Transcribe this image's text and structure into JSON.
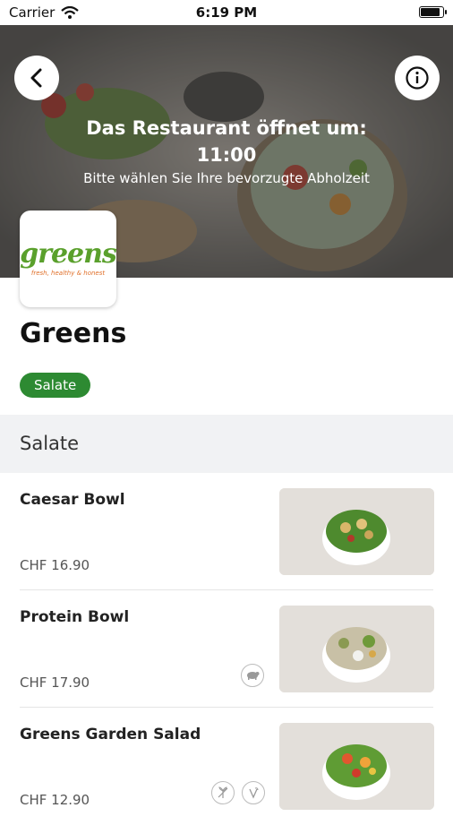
{
  "status_bar": {
    "carrier": "Carrier",
    "time": "6:19 PM",
    "battery_level": 0.9
  },
  "header": {
    "title": "Das Restaurant öffnet um:",
    "opening_time": "11:00",
    "subtitle": "Bitte wählen Sie Ihre bevorzugte Abholzeit",
    "back_icon": "chevron-left-icon",
    "info_icon": "info-icon"
  },
  "restaurant": {
    "logo_text": "greens",
    "logo_tagline": "fresh, healthy & honest",
    "name": "Greens",
    "category": "Salate",
    "accent_color": "#2d8a32"
  },
  "menu": {
    "section_title": "Salate",
    "items": [
      {
        "name": "Caesar Bowl",
        "price": "CHF 16.90",
        "icons": []
      },
      {
        "name": "Protein Bowl",
        "price": "CHF 17.90",
        "icons": [
          "meat-icon"
        ]
      },
      {
        "name": "Greens Garden Salad",
        "price": "CHF 12.90",
        "icons": [
          "gluten-free-icon",
          "vegetarian-icon"
        ]
      }
    ]
  }
}
